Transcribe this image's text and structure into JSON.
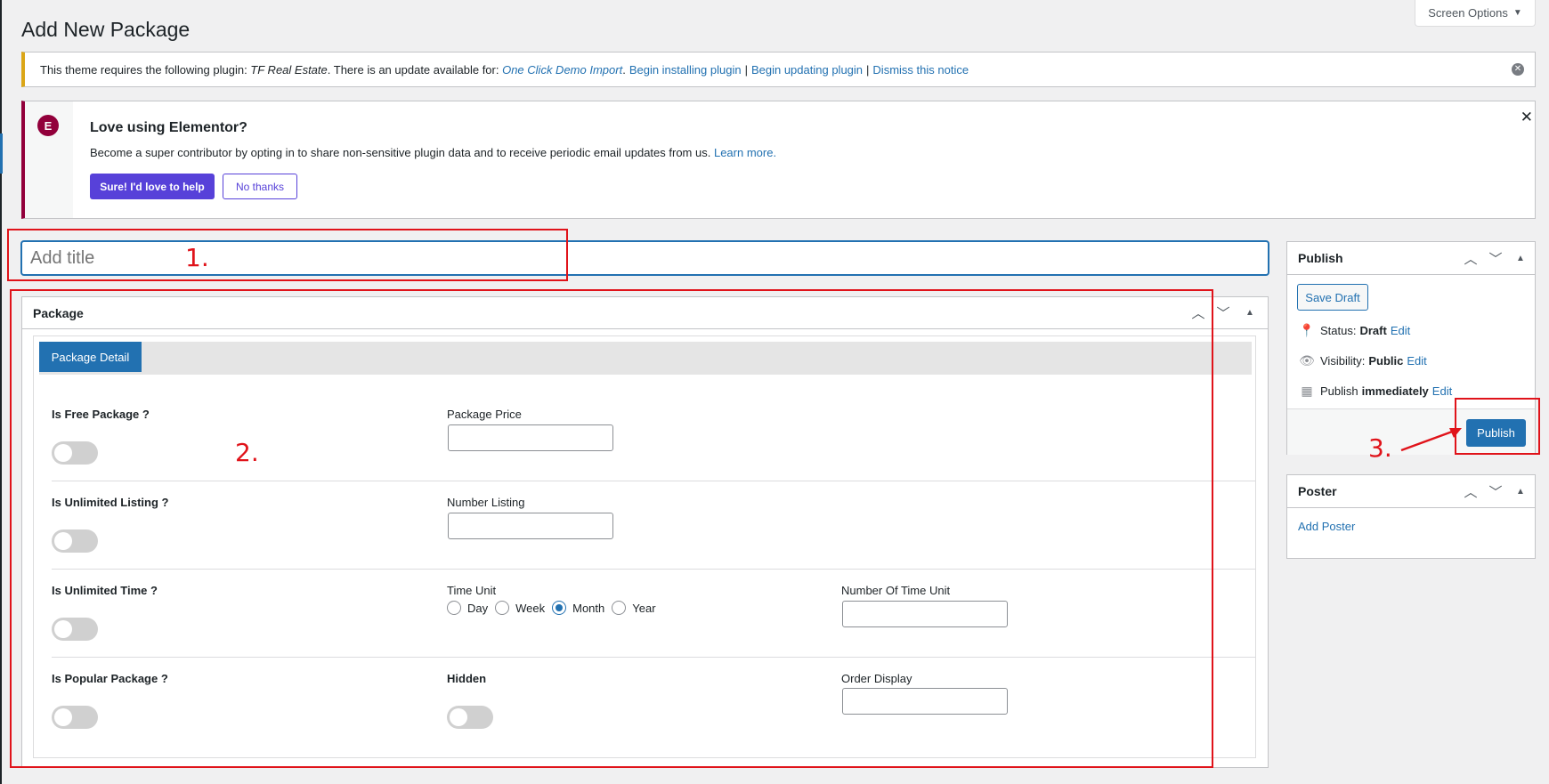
{
  "screen_options": {
    "label": "Screen Options",
    "arrow": "▼"
  },
  "page": {
    "title": "Add New Package"
  },
  "plugin_notice": {
    "text_prefix": "This theme requires the following plugin: ",
    "plugin_required": "TF Real Estate",
    "text_mid": ". There is an update available for: ",
    "plugin_update": "One Click Demo Import",
    "text_dot": ".",
    "link_install": "Begin installing plugin",
    "separator": "|",
    "link_update": "Begin updating plugin",
    "link_dismiss": "Dismiss this notice",
    "dismiss_icon": "close-circle-icon"
  },
  "elementor_notice": {
    "logo": "E",
    "title": "Love using Elementor?",
    "text": "Become a super contributor by opting in to share non-sensitive plugin data and to receive periodic email updates from us.",
    "learn_more": "Learn more.",
    "btn_yes": "Sure! I'd love to help",
    "btn_no": "No thanks",
    "close": "✕",
    "color": "#92003b"
  },
  "title_field": {
    "placeholder": "Add title"
  },
  "package_box": {
    "title": "Package",
    "tab": "Package Detail",
    "rows": [
      {
        "left_label": "Is Free Package ?",
        "mid_label": "Package Price"
      },
      {
        "left_label": "Is Unlimited Listing ?",
        "mid_label": "Number Listing"
      },
      {
        "left_label": "Is Unlimited Time ?",
        "mid_label": "Time Unit",
        "right_label": "Number Of Time Unit"
      },
      {
        "left_label": "Is Popular Package ?",
        "mid_label": "Hidden",
        "right_label": "Order Display"
      }
    ],
    "time_units": [
      "Day",
      "Week",
      "Month",
      "Year"
    ],
    "time_unit_selected": "Month"
  },
  "publish_box": {
    "title": "Publish",
    "save_draft": "Save Draft",
    "status_label": "Status:",
    "status_value": "Draft",
    "visibility_label": "Visibility:",
    "visibility_value": "Public",
    "publish_label": "Publish",
    "publish_value": "immediately",
    "edit": "Edit",
    "publish_button": "Publish",
    "accent": "#2271b1"
  },
  "poster_box": {
    "title": "Poster",
    "add_link": "Add Poster"
  },
  "annotations": {
    "one": "1.",
    "two": "2.",
    "three": "3.",
    "color": "#e0131a"
  }
}
